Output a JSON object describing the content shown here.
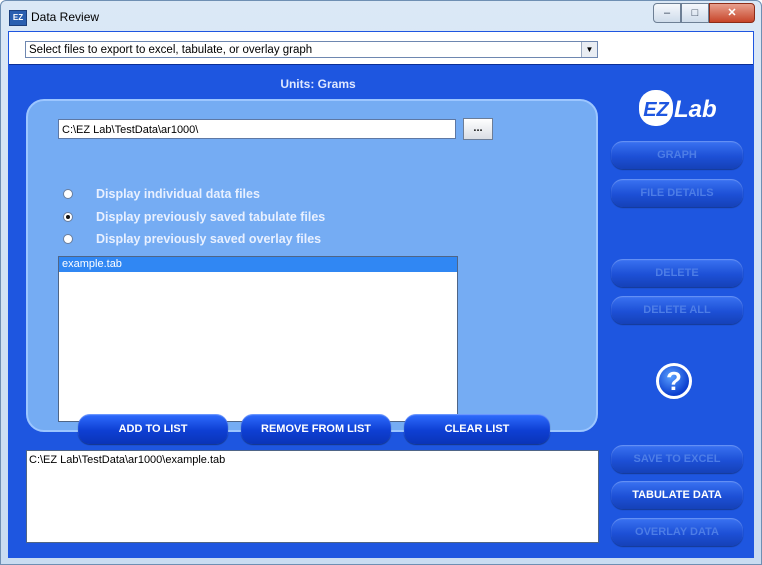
{
  "window": {
    "title": "Data Review",
    "icon_text": "EZ"
  },
  "top_select": {
    "value": "Select files to export to excel, tabulate, or overlay graph"
  },
  "units_label": "Units: Grams",
  "path": {
    "value": "C:\\EZ Lab\\TestData\\ar1000\\",
    "browse_label": "..."
  },
  "radios": [
    {
      "label": "Display individual data files",
      "checked": false
    },
    {
      "label": "Display previously saved tabulate files",
      "checked": true
    },
    {
      "label": "Display previously saved overlay files",
      "checked": false
    }
  ],
  "file_list": [
    "example.tab"
  ],
  "list_buttons": {
    "add": "ADD TO LIST",
    "remove": "REMOVE FROM LIST",
    "clear": "CLEAR LIST"
  },
  "selected_files": [
    "C:\\EZ Lab\\TestData\\ar1000\\example.tab"
  ],
  "side_buttons": {
    "graph": "GRAPH",
    "file_details": "FILE DETAILS",
    "delete": "DELETE",
    "delete_all": "DELETE ALL",
    "save_excel": "SAVE TO EXCEL",
    "tabulate": "TABULATE DATA",
    "overlay": "OVERLAY DATA"
  },
  "logo": {
    "text": "Lab",
    "badge": "EZ"
  },
  "help_symbol": "?",
  "colors": {
    "background": "#1e56e0",
    "panel": "#75acf3",
    "selection": "#3087f3"
  }
}
